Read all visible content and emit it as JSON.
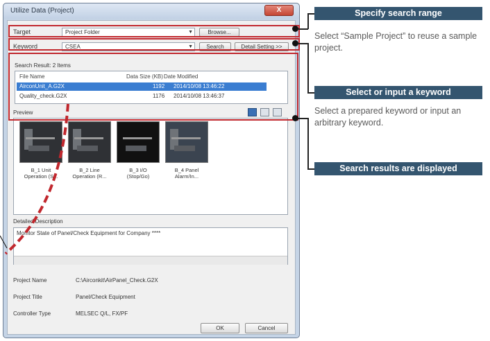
{
  "dialog": {
    "title": "Utilize Data (Project)",
    "close_label": "X",
    "target_label": "Target",
    "target_value": "Project Folder",
    "browse_label": "Browse...",
    "keyword_label": "Keyword",
    "keyword_value": "CSEA",
    "search_label": "Search",
    "detail_setting_label": "Detail Setting >>",
    "results_title": "Search Result: 2 Items",
    "columns": [
      "File Name",
      "Data Size (KB)",
      "Date Modified"
    ],
    "rows": [
      {
        "name": "AirconUnit_A.G2X",
        "size": "1192",
        "date": "2014/10/08 13:46:22"
      },
      {
        "name": "Quality_check.G2X",
        "size": "1176",
        "date": "2014/10/08 13:46:37"
      }
    ],
    "preview_label": "Preview",
    "thumbs": [
      {
        "line1": "B_1 Unit",
        "line2": "Operation (S..."
      },
      {
        "line1": "B_2 Line",
        "line2": "Operation (R..."
      },
      {
        "line1": "B_3 I/O",
        "line2": "(Stop/Go)"
      },
      {
        "line1": "B_4 Panel",
        "line2": "Alarm/In..."
      }
    ],
    "description_label": "Detailed Description",
    "description_text": "Monitor State of Panel/Check Equipment for Company ****",
    "project_name_label": "Project Name",
    "project_name_value": "C:\\Airconkit\\AirPanel_Check.G2X",
    "project_title_label": "Project Title",
    "project_title_value": "Panel/Check Equipment",
    "controller_label": "Controller Type",
    "controller_value": "MELSEC Q/L, FX/PF",
    "ok_label": "OK",
    "cancel_label": "Cancel"
  },
  "callouts": [
    {
      "title": "Specify search range",
      "desc": "Select “Sample Project” to reuse a sample project."
    },
    {
      "title": "Select or input a keyword",
      "desc": "Select a prepared keyword or input an arbitrary keyword."
    },
    {
      "title": "Search results are displayed",
      "desc": ""
    }
  ],
  "colors": {
    "highlight": "#c1272d",
    "callout_bg": "#34556f",
    "selection": "#3a7dd1"
  }
}
